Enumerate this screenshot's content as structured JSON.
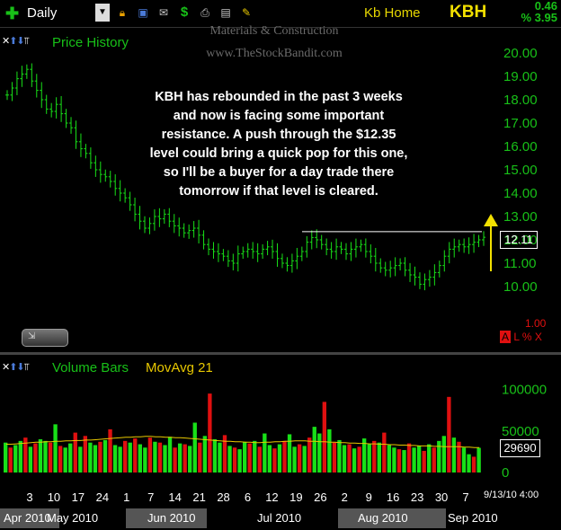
{
  "toolbar": {
    "period": "Daily",
    "company": "Kb Home",
    "symbol": "KBH",
    "change": "0.46",
    "change_pct": "% 3.95",
    "icons": [
      "lock-icon",
      "save-icon",
      "email-icon",
      "dollar-icon",
      "print-icon",
      "card-icon",
      "pencil-icon"
    ]
  },
  "watermark": {
    "line1": "Materials & Construction",
    "line2": "www.TheStockBandit.com"
  },
  "price_pane": {
    "title": "Price History",
    "annotation_lines": [
      "KBH has rebounded in the past 3 weeks",
      "and now is facing some important",
      "resistance.  A push through the $12.35",
      "level could bring a quick pop for this one,",
      "so I'll be a buyer for a day trade there",
      "tomorrow if that level is cleared."
    ],
    "last_price": "12.11",
    "scale_label": "1.00",
    "alx": {
      "a": "A",
      "rest": " L % X"
    }
  },
  "volume_pane": {
    "title": "Volume Bars",
    "ma_label": "MovAvg 21",
    "last_volume": "29690"
  },
  "x_axis": {
    "day_ticks": [
      "3",
      "10",
      "17",
      "24",
      "1",
      "7",
      "14",
      "21",
      "28",
      "6",
      "12",
      "19",
      "26",
      "2",
      "9",
      "16",
      "23",
      "30",
      "7"
    ],
    "months": [
      "Apr 2010",
      "May 2010",
      "Jun 2010",
      "Jul 2010",
      "Aug 2010",
      "Sep 2010"
    ],
    "date_stamp": "9/13/10 4:00"
  },
  "colors": {
    "up": "#18e018",
    "down": "#e01010",
    "axis_text": "#18c018",
    "ma": "#e8c800",
    "resistance": "#ffffff",
    "arrow": "#f2e000"
  },
  "chart_data": [
    {
      "type": "line",
      "title": "Price History",
      "ylim": [
        9.5,
        20.5
      ],
      "y_ticks": [
        10,
        11,
        12,
        13,
        14,
        15,
        16,
        17,
        18,
        19,
        20
      ],
      "resistance": 12.35,
      "series": [
        {
          "name": "KBH",
          "values": [
            18.2,
            18.5,
            18.9,
            19.1,
            19.3,
            18.8,
            18.4,
            18.0,
            17.6,
            17.5,
            17.8,
            17.4,
            17.0,
            16.8,
            16.2,
            15.9,
            15.7,
            15.3,
            15.0,
            14.8,
            14.7,
            14.5,
            14.2,
            14.0,
            13.8,
            13.5,
            13.1,
            12.8,
            12.5,
            12.7,
            13.0,
            12.9,
            13.1,
            12.8,
            12.6,
            12.5,
            12.3,
            12.4,
            12.5,
            12.2,
            11.8,
            11.6,
            11.5,
            11.4,
            11.3,
            11.1,
            11.0,
            11.4,
            11.5,
            11.6,
            11.5,
            11.4,
            11.6,
            11.7,
            11.5,
            11.2,
            11.0,
            10.9,
            11.1,
            11.3,
            11.5,
            11.9,
            12.1,
            12.0,
            11.8,
            11.6,
            11.5,
            11.7,
            11.6,
            11.4,
            11.6,
            11.7,
            11.8,
            11.5,
            11.3,
            11.0,
            10.8,
            10.7,
            10.8,
            10.9,
            11.0,
            10.7,
            10.5,
            10.4,
            10.1,
            10.3,
            10.4,
            10.6,
            10.9,
            11.3,
            11.6,
            11.7,
            11.8,
            11.7,
            11.8,
            11.9,
            12.0,
            12.11
          ]
        }
      ]
    },
    {
      "type": "bar",
      "title": "Volume Bars",
      "ylim": [
        0,
        120000
      ],
      "y_ticks": [
        0,
        50000,
        100000
      ],
      "series": [
        {
          "name": "Volume",
          "values": [
            36000,
            30000,
            33000,
            38000,
            42000,
            31000,
            35000,
            40000,
            38000,
            36000,
            58000,
            32000,
            30000,
            35000,
            48000,
            31000,
            44000,
            36000,
            33000,
            37000,
            39000,
            52000,
            33000,
            31000,
            38000,
            36000,
            41000,
            34000,
            30000,
            42000,
            37000,
            36000,
            33000,
            43000,
            30000,
            35000,
            34000,
            32000,
            60000,
            36000,
            44000,
            95000,
            40000,
            36000,
            45000,
            32000,
            30000,
            28000,
            37000,
            35000,
            38000,
            31000,
            47000,
            33000,
            29000,
            34000,
            38000,
            46000,
            31000,
            34000,
            32000,
            42000,
            55000,
            47000,
            85000,
            52000,
            36000,
            39000,
            33000,
            34000,
            29000,
            31000,
            41000,
            34000,
            38000,
            36000,
            48000,
            33000,
            30000,
            28000,
            27000,
            35000,
            30000,
            32000,
            26000,
            34000,
            30000,
            38000,
            44000,
            91000,
            42000,
            37000,
            30000,
            22000,
            19000,
            29690
          ]
        },
        {
          "name": "MovAvg 21",
          "values": [
            34000,
            34000,
            34500,
            35000,
            35500,
            36000,
            36500,
            36500,
            37000,
            37000,
            37500,
            37500,
            38000,
            38000,
            38500,
            38500,
            39000,
            39000,
            39500,
            40000,
            40500,
            41000,
            41500,
            42000,
            42500,
            42500,
            43000,
            43000,
            43500,
            43500,
            43000,
            43000,
            42500,
            42500,
            42000,
            42000,
            41500,
            41000,
            40500,
            40000,
            39500,
            39000,
            38500,
            38000,
            37500,
            37500,
            37000,
            37000,
            36500,
            36500,
            36000,
            36000,
            36500,
            36500,
            37000,
            37000,
            37500,
            37500,
            38000,
            38000,
            38000,
            37500,
            37500,
            37000,
            37000,
            36500,
            36500,
            36000,
            36000,
            35500,
            35500,
            35000,
            35000,
            34500,
            34500,
            34000,
            34000,
            33500,
            33500,
            33000,
            33000,
            32500,
            32500,
            32000,
            32000,
            32000,
            31500,
            31500,
            31000,
            31000,
            31000,
            31000,
            30500,
            30500,
            30000,
            30000
          ]
        }
      ]
    }
  ]
}
